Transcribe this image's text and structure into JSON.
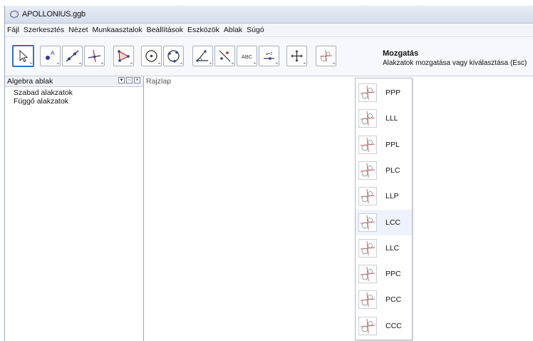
{
  "window": {
    "title": "APOLLONIUS.ggb"
  },
  "menu": [
    "Fájl",
    "Szerkesztés",
    "Nézet",
    "Munkaasztalok",
    "Beállítások",
    "Eszközök",
    "Ablak",
    "Súgó"
  ],
  "toolbar": {
    "text_tool_label": "ABC",
    "slider_tool_label": "a=2",
    "active_tool": {
      "name": "Mozgatás",
      "description": "Alakzatok mozgatása vagy kiválasztása (Esc)"
    }
  },
  "algebra": {
    "title": "Algebra ablak",
    "items": [
      "Szabad alakzatok",
      "Függő alakzatok"
    ]
  },
  "drawing": {
    "title": "Rajzlap"
  },
  "dropdown": {
    "hovered": "LCC",
    "items": [
      "PPP",
      "LLL",
      "PPL",
      "PLC",
      "LLP",
      "LCC",
      "LLC",
      "PPC",
      "PCC",
      "CCC"
    ]
  }
}
